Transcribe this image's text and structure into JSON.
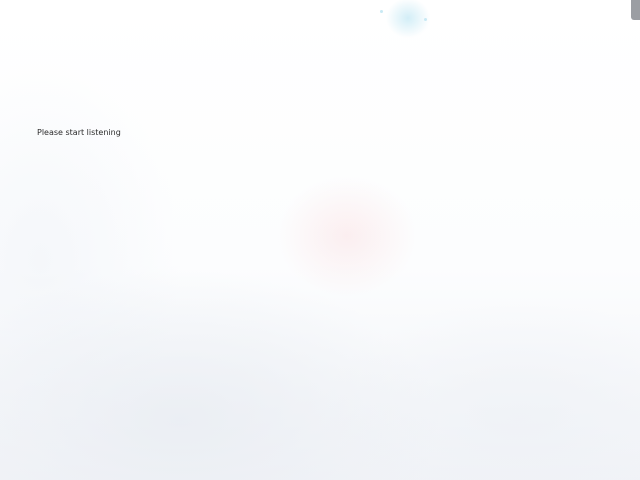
{
  "status": {
    "message": "Please start listening"
  },
  "theme": {
    "background": "#fdfdfe",
    "text_color": "#2b2b2b",
    "scrollbar_color": "#9b9ea3"
  }
}
